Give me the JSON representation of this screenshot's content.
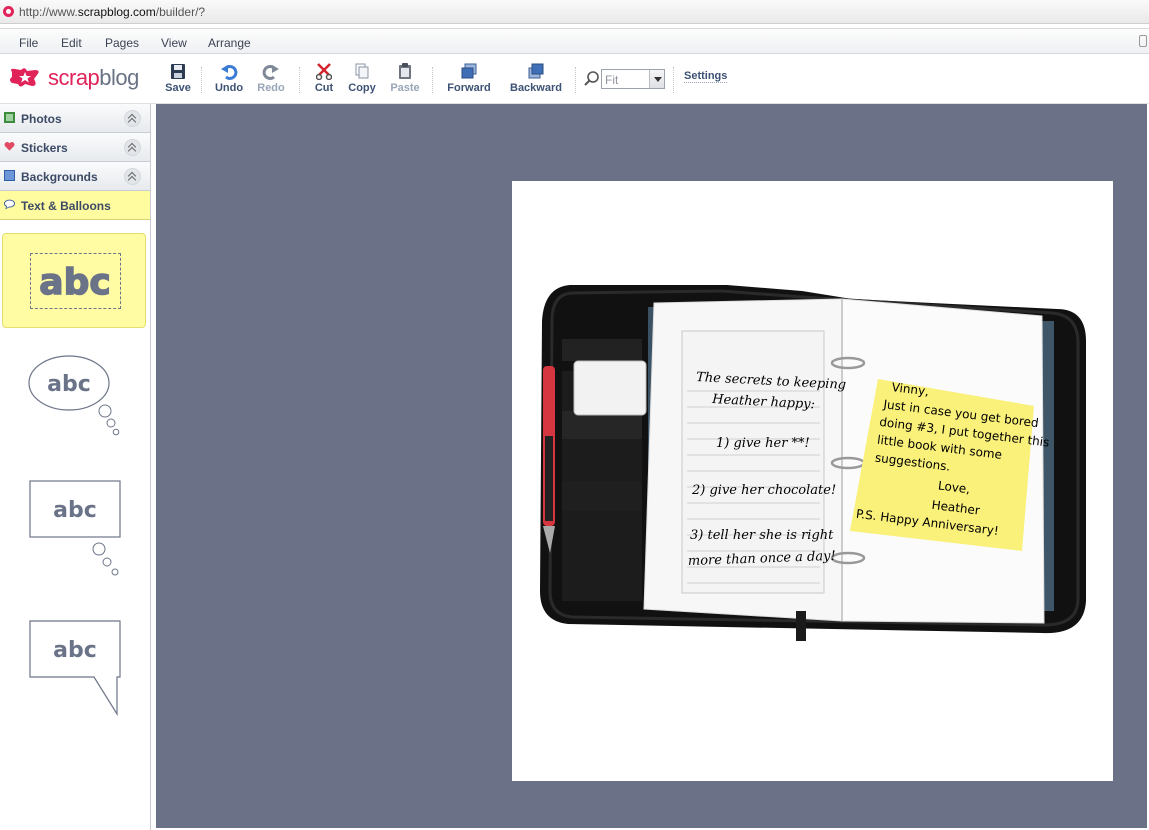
{
  "browser": {
    "url_prefix": "http://www.",
    "url_domain": "scrapblog.com",
    "url_path": "/builder/?"
  },
  "menu": [
    "File",
    "Edit",
    "Pages",
    "View",
    "Arrange"
  ],
  "logo": {
    "part1": "scrap",
    "part2": "blog",
    "accent": "#e0245a"
  },
  "toolbar": {
    "save": "Save",
    "undo": "Undo",
    "redo": "Redo",
    "cut": "Cut",
    "copy": "Copy",
    "paste": "Paste",
    "forward": "Forward",
    "backward": "Backward",
    "zoom_value": "Fit",
    "settings": "Settings"
  },
  "sidebar": {
    "sections": [
      {
        "label": "Photos",
        "icon": "photo-icon"
      },
      {
        "label": "Stickers",
        "icon": "heart-icon"
      },
      {
        "label": "Backgrounds",
        "icon": "background-icon"
      },
      {
        "label": "Text & Balloons",
        "icon": "balloon-icon"
      }
    ],
    "balloon_sample": "abc"
  },
  "canvas": {
    "background": "#6b7288",
    "notebook_left": {
      "line1": "The secrets to keeping",
      "line2": "Heather happy:",
      "item1": "1) give her **!",
      "item2": "2) give her chocolate!",
      "item3a": "3) tell her she is right",
      "item3b": "more than once a day!"
    },
    "sticky": {
      "l1": "Vinny,",
      "l2": "Just in case you get bored",
      "l3": "doing #3, I put together this",
      "l4": "little book with some",
      "l5": "suggestions.",
      "l6": "Love,",
      "l7": "Heather",
      "l8": "P.S. Happy Anniversary!"
    }
  }
}
